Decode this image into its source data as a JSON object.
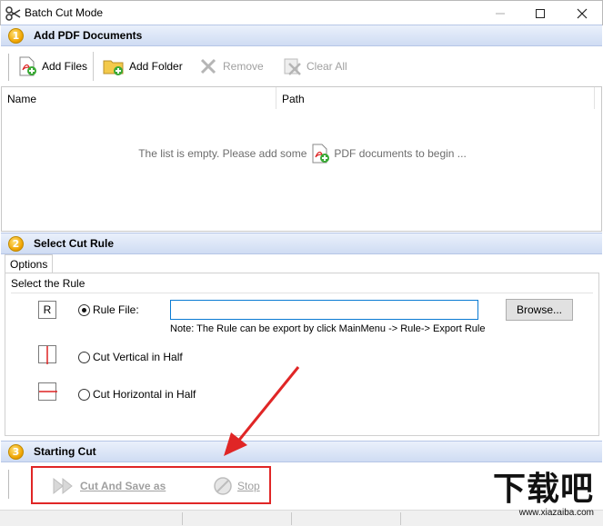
{
  "window": {
    "title": "Batch Cut Mode"
  },
  "sections": {
    "add": {
      "number": "1",
      "title": "Add PDF Documents"
    },
    "rule": {
      "number": "2",
      "title": "Select Cut Rule"
    },
    "start": {
      "number": "3",
      "title": "Starting Cut"
    }
  },
  "toolbar": {
    "add_files": "Add Files",
    "add_folder": "Add Folder",
    "remove": "Remove",
    "clear_all": "Clear All"
  },
  "list": {
    "columns": [
      "Name",
      "Path"
    ],
    "empty_prefix": "The list is empty. Please add some",
    "empty_suffix": "PDF documents to begin ..."
  },
  "options": {
    "tab": "Options",
    "group": "Select the Rule",
    "rule_icon_letter": "R",
    "rule_file_label": "Rule File:",
    "rule_file_value": "",
    "browse": "Browse...",
    "note": "Note: The Rule can be export by click MainMenu -> Rule-> Export Rule",
    "vertical_label": "Cut Vertical in Half",
    "horizontal_label": "Cut Horizontal in Half",
    "selected": "rule_file"
  },
  "actions": {
    "cut_save": "Cut And Save as",
    "stop": "Stop"
  },
  "watermark": {
    "text": "下载吧",
    "url": "www.xiazaiba.com"
  },
  "colors": {
    "accent_red": "#e02626",
    "header_blue": "#cfdcf3",
    "badge_orange": "#f0a400"
  }
}
